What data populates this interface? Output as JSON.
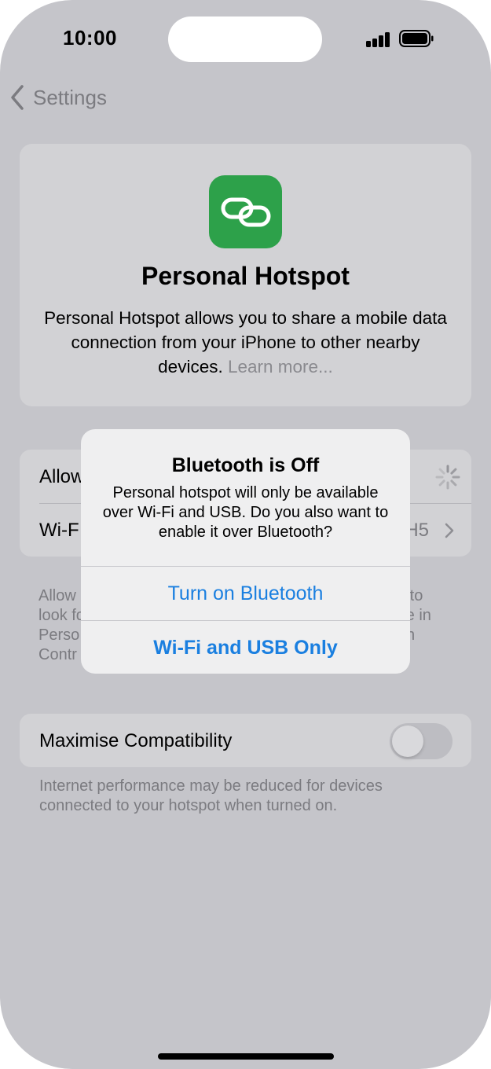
{
  "status_bar": {
    "time": "10:00"
  },
  "nav": {
    "back_label": "Settings"
  },
  "hero": {
    "title": "Personal Hotspot",
    "description": "Personal Hotspot allows you to share a mobile data connection from your iPhone to other nearby devices.",
    "learn_more": "Learn more..."
  },
  "settings": {
    "allow_others_label": "Allow",
    "wifi_password_label": "Wi-F",
    "wifi_password_value": "H5"
  },
  "footnote_lines": [
    "Allow",
    "look fo",
    "Perso",
    "Contr"
  ],
  "footnote_right_lines": [
    "d to",
    "re in",
    "n"
  ],
  "compatibility": {
    "label": "Maximise Compatibility",
    "enabled": false,
    "footnote": "Internet performance may be reduced for devices connected to your hotspot when turned on."
  },
  "alert": {
    "title": "Bluetooth is Off",
    "message": "Personal hotspot will only be available over Wi-Fi and USB. Do you also want to enable it over Bluetooth?",
    "primary_button": "Turn on Bluetooth",
    "secondary_button": "Wi-Fi and USB Only"
  },
  "colors": {
    "accent": "#1a7fe0",
    "app_icon": "#2da14a",
    "dimmed_background": "#c5c5ca"
  }
}
